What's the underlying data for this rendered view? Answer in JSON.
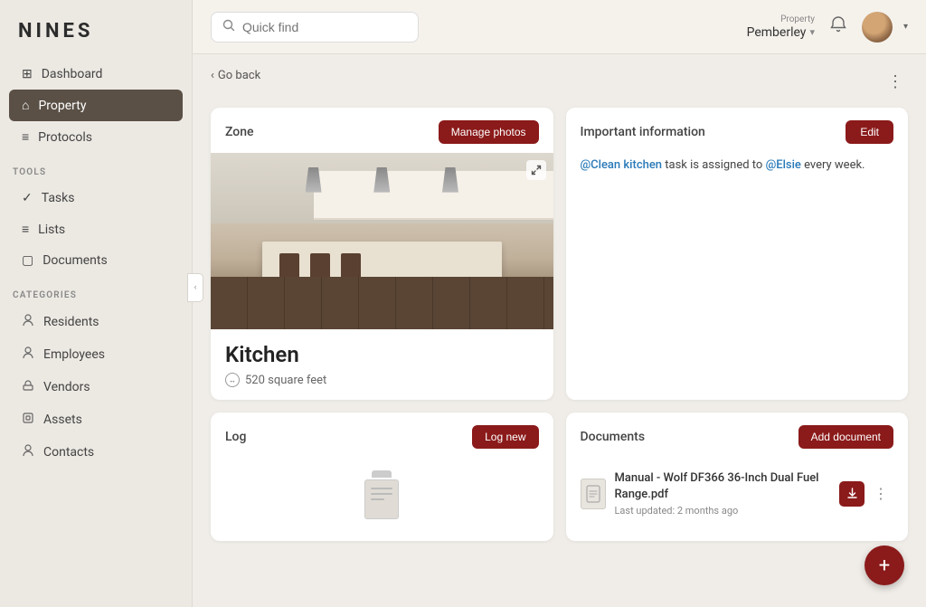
{
  "app": {
    "logo": "NINES"
  },
  "sidebar": {
    "nav_main": [
      {
        "id": "dashboard",
        "label": "Dashboard",
        "icon": "⊞"
      },
      {
        "id": "property",
        "label": "Property",
        "icon": "⌂",
        "active": true
      },
      {
        "id": "protocols",
        "label": "Protocols",
        "icon": "≡"
      }
    ],
    "tools_label": "TOOLS",
    "tools": [
      {
        "id": "tasks",
        "label": "Tasks",
        "icon": "✓"
      },
      {
        "id": "lists",
        "label": "Lists",
        "icon": "≡"
      },
      {
        "id": "documents",
        "label": "Documents",
        "icon": "▢"
      }
    ],
    "categories_label": "CATEGORIES",
    "categories": [
      {
        "id": "residents",
        "label": "Residents",
        "icon": "👤"
      },
      {
        "id": "employees",
        "label": "Employees",
        "icon": "👤"
      },
      {
        "id": "vendors",
        "label": "Vendors",
        "icon": "🔧"
      },
      {
        "id": "assets",
        "label": "Assets",
        "icon": "🗄"
      },
      {
        "id": "contacts",
        "label": "Contacts",
        "icon": "👤"
      }
    ]
  },
  "topbar": {
    "search_placeholder": "Quick find",
    "property_label": "Property",
    "property_value": "Pemberley",
    "property_caret": "▾"
  },
  "content": {
    "back_label": "Go back",
    "more_label": "⋮",
    "zone_card": {
      "header": "Zone",
      "manage_photos_btn": "Manage photos",
      "title": "Kitchen",
      "sqft_text": "520 square feet"
    },
    "info_card": {
      "header": "Important information",
      "edit_btn": "Edit",
      "text_before_link1": "",
      "link1_text": "@Clean kitchen",
      "text_middle": " task is assigned to ",
      "link2_text": "@Elsie",
      "text_after": " every week."
    },
    "log_card": {
      "header": "Log",
      "log_new_btn": "Log new"
    },
    "doc_card": {
      "header": "Documents",
      "add_doc_btn": "Add document",
      "doc_name": "Manual - Wolf DF366 36-Inch Dual Fuel Range.pdf",
      "doc_date": "Last updated: 2 months ago"
    }
  },
  "fab_label": "+"
}
